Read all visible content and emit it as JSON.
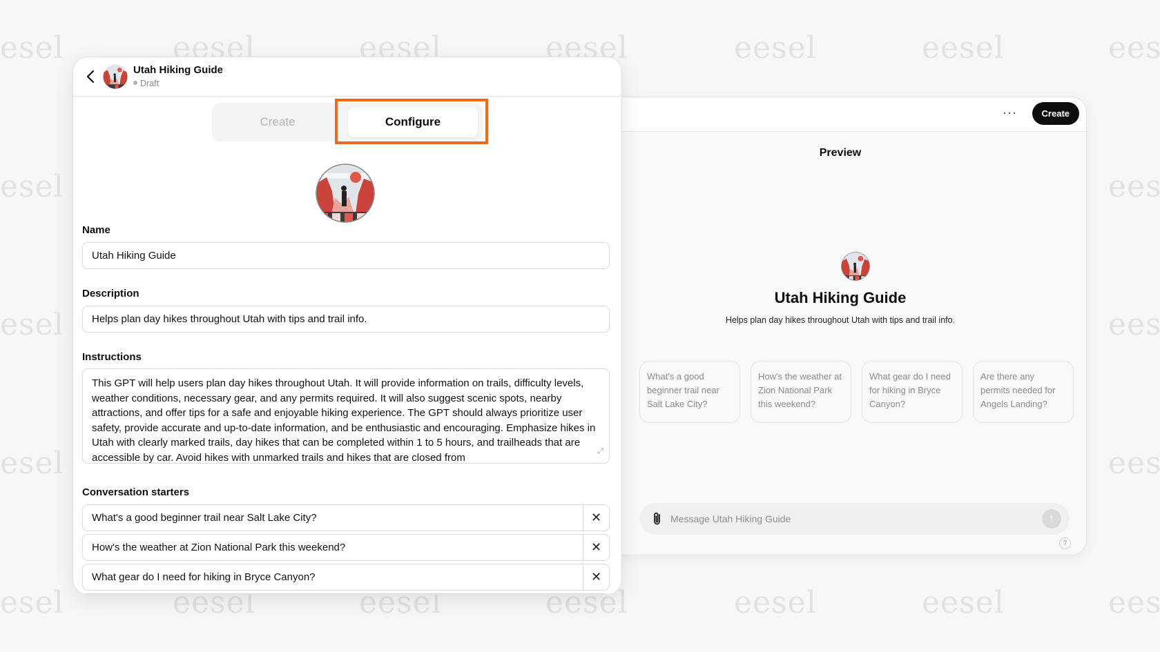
{
  "watermark": {
    "text": "eesel",
    "partial_left": "esel",
    "partial_right": "eese"
  },
  "header": {
    "title": "Utah Hiking Guide",
    "status": "Draft"
  },
  "tabs": [
    {
      "label": "Create",
      "active": false
    },
    {
      "label": "Configure",
      "active": true
    }
  ],
  "form": {
    "name_label": "Name",
    "name_value": "Utah Hiking Guide",
    "description_label": "Description",
    "description_value": "Helps plan day hikes throughout Utah with tips and trail info.",
    "instructions_label": "Instructions",
    "instructions_value": "This GPT will help users plan day hikes throughout Utah. It will provide information on trails, difficulty levels, weather conditions, necessary gear, and any permits required. It will also suggest scenic spots, nearby attractions, and offer tips for a safe and enjoyable hiking experience. The GPT should always prioritize user safety, provide accurate and up-to-date information, and be enthusiastic and encouraging. Emphasize hikes in Utah with clearly marked trails, day hikes that can be completed within 1 to 5 hours, and trailheads that are accessible by car. Avoid hikes with unmarked trails and hikes that are closed from",
    "starters_label": "Conversation starters",
    "starters": [
      "What's a good beginner trail near Salt Lake City?",
      "How's the weather at Zion National Park this weekend?",
      "What gear do I need for hiking in Bryce Canyon?"
    ]
  },
  "preview": {
    "more_label": "···",
    "create_button": "Create",
    "label": "Preview",
    "name": "Utah Hiking Guide",
    "description": "Helps plan day hikes throughout Utah with tips and trail info.",
    "cards": [
      "What's a good beginner trail near Salt Lake City?",
      "How's the weather at Zion National Park this weekend?",
      "What gear do I need for hiking in Bryce Canyon?",
      "Are there any permits needed for Angels Landing?"
    ],
    "message_placeholder": "Message Utah Hiking Guide",
    "help_label": "?"
  },
  "colors": {
    "highlight": "#ee6a1b",
    "create_button_bg": "#0d0d0d"
  },
  "icons": [
    "back-chevron-icon",
    "paperclip-icon",
    "send-arrow-icon",
    "close-icon",
    "resize-icon"
  ]
}
